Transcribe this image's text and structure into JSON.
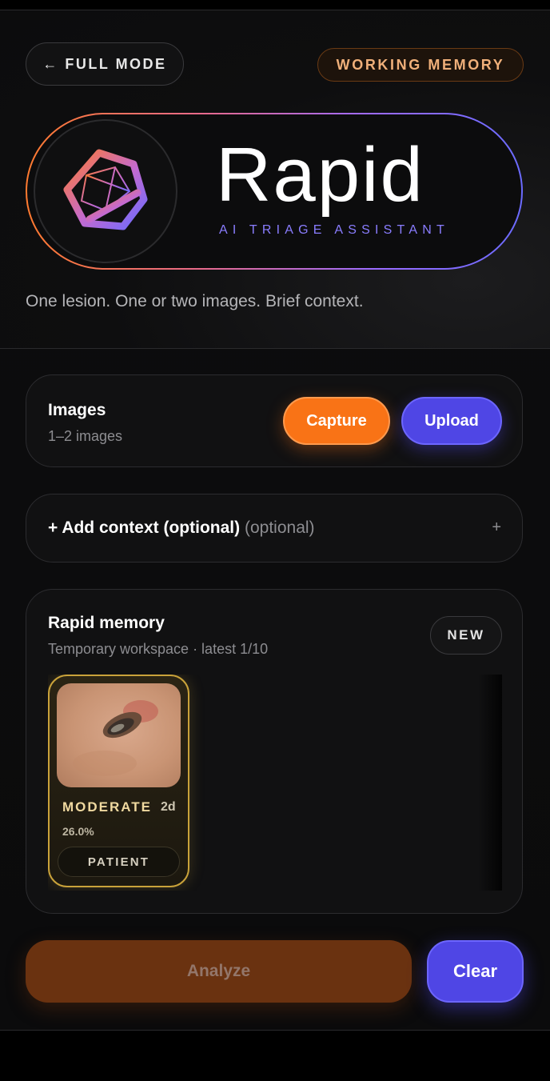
{
  "header": {
    "full_mode_arrow": "←",
    "full_mode_label": "FULL MODE",
    "memory_badge": "WORKING MEMORY"
  },
  "brand": {
    "title": "Rapid",
    "subtitle": "AI TRIAGE ASSISTANT",
    "logo_icon": "hexagon-cube-logo-icon",
    "tagline": "One lesion. One or two images. Brief context."
  },
  "images_card": {
    "title": "Images",
    "subtitle": "1–2 images",
    "capture_label": "Capture",
    "upload_label": "Upload"
  },
  "context_card": {
    "label": "+ Add context (optional)",
    "optional_hint": "(optional)",
    "plus_icon": "+"
  },
  "memory_card": {
    "title": "Rapid memory",
    "subtitle": "Temporary workspace · latest 1/10",
    "new_label": "NEW",
    "items": [
      {
        "severity": "MODERATE",
        "age": "2d",
        "percent": "26.0%",
        "tag": "PATIENT"
      }
    ]
  },
  "actions": {
    "analyze_label": "Analyze",
    "clear_label": "Clear"
  },
  "colors": {
    "accent_orange": "#f97316",
    "accent_indigo": "#4f46e5",
    "memory_gold": "#c9a23a",
    "background": "#0c0c0d"
  }
}
